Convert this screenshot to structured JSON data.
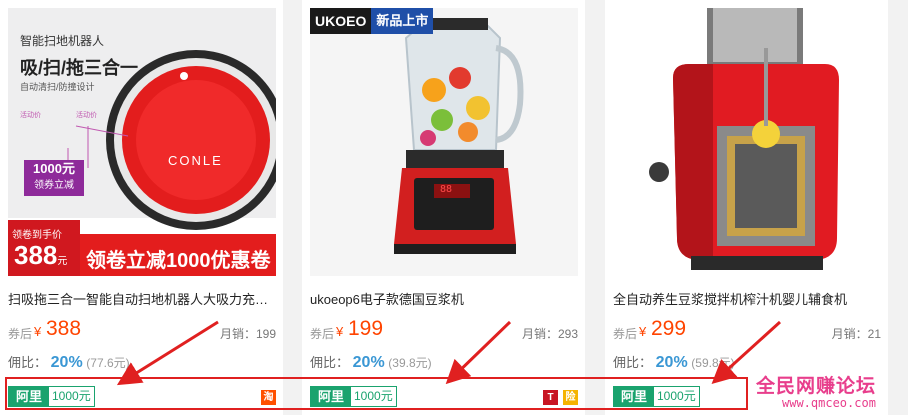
{
  "products": [
    {
      "title": "扫吸拖三合一智能自动扫地机器人大吸力充电家…",
      "price_label": "券后",
      "currency": "¥",
      "price": "388",
      "sales": "月销：199",
      "commission_label": "佣比：",
      "commission_rate": "20%",
      "commission_amount": "(77.6元)",
      "coupon_platform": "阿里",
      "coupon_value": "1000元",
      "shop_badges": [
        "淘"
      ],
      "image": {
        "headline": "智能扫地机器人",
        "slogan": "吸/扫/拖三合一",
        "subtitle": "自动清扫/防撞设计",
        "brand": "CONLE",
        "badge_amount": "1000元",
        "badge_text": "领券立减",
        "corner_label": "领卷到手价",
        "corner_price": "388",
        "corner_unit": "元",
        "banner": "领卷立减1000优惠卷",
        "hint_a": "活动价",
        "hint_b": "活动价"
      }
    },
    {
      "title": "ukoeop6电子款德国豆浆机",
      "price_label": "券后",
      "currency": "¥",
      "price": "199",
      "sales": "月销：293",
      "commission_label": "佣比：",
      "commission_rate": "20%",
      "commission_amount": "(39.8元)",
      "coupon_platform": "阿里",
      "coupon_value": "1000元",
      "shop_badges": [
        "T",
        "险"
      ],
      "image": {
        "brand": "UKOEO",
        "new_tag": "新品上市",
        "display": "88"
      }
    },
    {
      "title": "全自动养生豆浆搅拌机榨汁机婴儿辅食机",
      "price_label": "券后",
      "currency": "¥",
      "price": "299",
      "sales": "月销：21",
      "commission_label": "佣比：",
      "commission_rate": "20%",
      "commission_amount": "(59.8元)",
      "coupon_platform": "阿里",
      "coupon_value": "1000元",
      "shop_badges": [],
      "image": {}
    }
  ],
  "watermark": {
    "text": "全民网赚论坛",
    "url": "www.qmceo.com"
  },
  "colors": {
    "price": "#ff4400",
    "commission": "#3a97d4",
    "coupon": "#1aa36e",
    "annotation": "#e02020"
  }
}
